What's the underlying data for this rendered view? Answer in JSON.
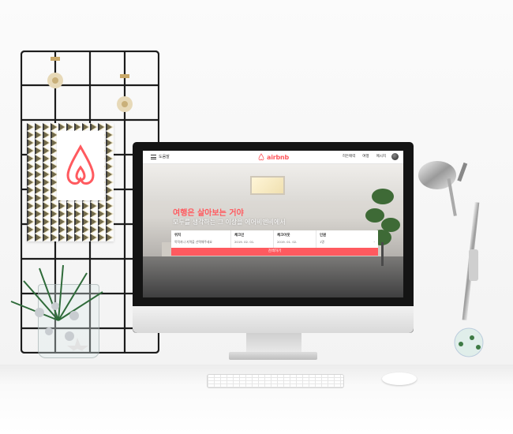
{
  "header": {
    "menu_label": "도움말",
    "brand_name": "airbnb",
    "nav_items": [
      "히든매력",
      "여행",
      "메시지"
    ]
  },
  "hero": {
    "title": "여행은 살아보는 거야",
    "subtitle": "모두를 생각하는 그 이상을 에어비앤비에서"
  },
  "search_form": {
    "fields": [
      {
        "label": "위치",
        "value": "목적지나 지역을 선택해주세요"
      },
      {
        "label": "체크인",
        "value": "2019. 02. 01."
      },
      {
        "label": "체크아웃",
        "value": "2019. 01. 02."
      },
      {
        "label": "인원",
        "value": "1명",
        "stepper": "-"
      }
    ],
    "search_button_label": "검색하기"
  },
  "colors": {
    "brand": "#ff5a5f",
    "header_bg": "#ffffff",
    "frame": "#141414"
  }
}
